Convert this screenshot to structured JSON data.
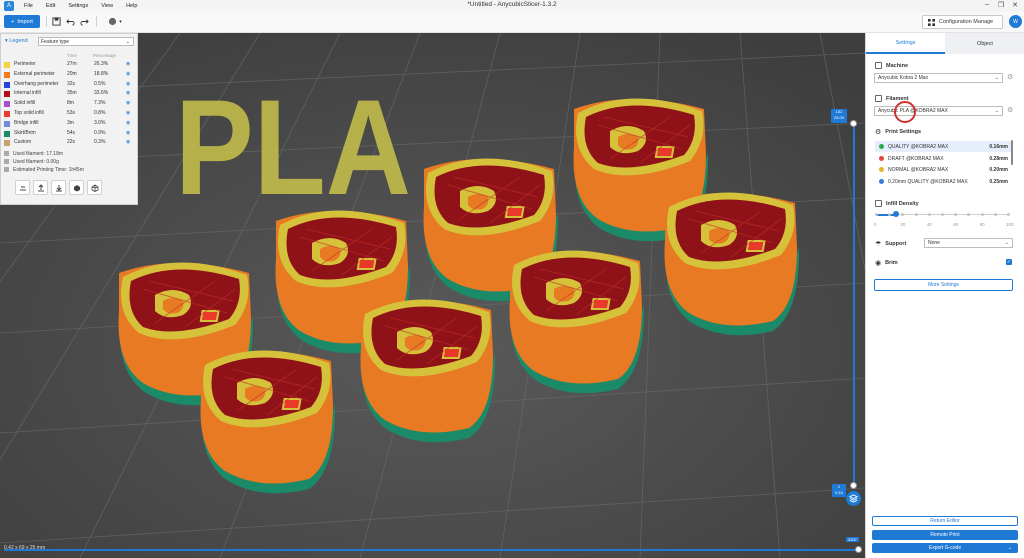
{
  "titlebar": {
    "title": "*Untitled - AnycubicSlicer-1.3.2",
    "menu": [
      "File",
      "Edit",
      "Settings",
      "View",
      "Help"
    ]
  },
  "toolbar": {
    "import_label": "Import",
    "config_label": "Configuration Manage",
    "user_initial": "W"
  },
  "legend": {
    "title": "Legend",
    "view_type": "Feature type",
    "col_time": "Time",
    "col_pct": "Percentage",
    "rows": [
      {
        "name": "Perimeter",
        "time": "27m",
        "pct": "26.3%",
        "color": "#f5d63a"
      },
      {
        "name": "External perimeter",
        "time": "20m",
        "pct": "18.8%",
        "color": "#f07a1c"
      },
      {
        "name": "Overhang perimeter",
        "time": "32s",
        "pct": "0.5%",
        "color": "#2a43d6"
      },
      {
        "name": "Internal infill",
        "time": "35m",
        "pct": "33.6%",
        "color": "#b3121c"
      },
      {
        "name": "Solid infill",
        "time": "8m",
        "pct": "7.3%",
        "color": "#a64fd1"
      },
      {
        "name": "Top solid infill",
        "time": "53s",
        "pct": "0.8%",
        "color": "#e8392a"
      },
      {
        "name": "Bridge infill",
        "time": "3m",
        "pct": "3.0%",
        "color": "#6d8be0"
      },
      {
        "name": "Skirt/Brim",
        "time": "54s",
        "pct": "0.9%",
        "color": "#1a8a68"
      },
      {
        "name": "Custom",
        "time": "22s",
        "pct": "0.3%",
        "color": "#c8a46a"
      }
    ],
    "used_filament_m": "Used filament:  17.18m",
    "used_filament_g": "Used filament:  0.00g",
    "est_time": "Estimated Printing Time:  1h45m"
  },
  "panel": {
    "tab_settings": "Settings",
    "tab_object": "Object",
    "machine_title": "Machine",
    "machine_value": "Anycubic Kobra 2 Max",
    "filament_title": "Filament",
    "filament_value": "Anycubic PLA @KOBRA2 MAX",
    "print_settings_title": "Print Settings",
    "print_presets": [
      {
        "name": "QUALITY @KOBRA2 MAX",
        "value": "0.16mm",
        "color": "#2fa84f"
      },
      {
        "name": "DRAFT @KOBRA2 MAX",
        "value": "0.28mm",
        "color": "#e3483a"
      },
      {
        "name": "NORMAL @KOBRA2 MAX",
        "value": "0.20mm",
        "color": "#e8b430"
      },
      {
        "name": "0.20mm QUALITY @KOBRA2 MAX",
        "value": "0.25mm",
        "color": "#3a7bd5"
      }
    ],
    "infill_title": "Infill Density",
    "infill_value_pct": 15,
    "infill_ticks": [
      "0",
      "20",
      "40",
      "60",
      "80",
      "100"
    ],
    "support_title": "Support",
    "support_value": "None",
    "brim_title": "Brim",
    "more_settings": "More Settings",
    "return_editor": "Return Editor",
    "remote_print": "Remote Print",
    "export_gcode": "Export G-code"
  },
  "viewport": {
    "dims": "0.42 x 69 x 25 mm",
    "bed_text": "PLA",
    "layer_top": "152\n25.00",
    "layer_bottom": "1\n0.16",
    "move_count": "3307"
  }
}
